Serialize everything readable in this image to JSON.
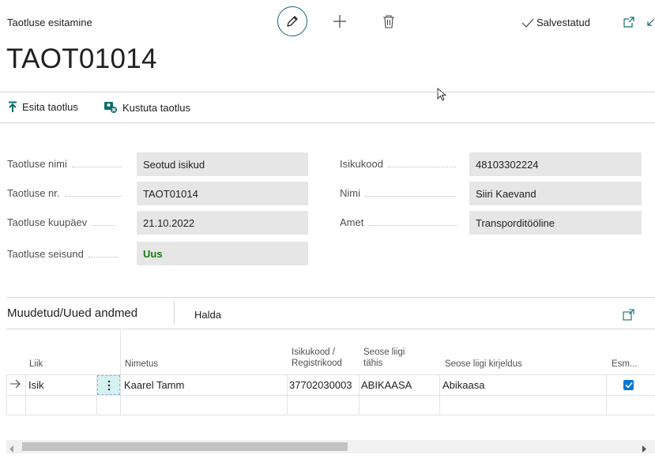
{
  "header": {
    "caption": "Taotluse esitamine",
    "title": "TAOT01014",
    "saved_status": "Salvestatud"
  },
  "actions": {
    "submit": "Esita taotlus",
    "delete": "Kustuta taotlus"
  },
  "fields_left": [
    {
      "label": "Taotluse nimi",
      "value": "Seotud isikud"
    },
    {
      "label": "Taotluse nr.",
      "value": "TAOT01014"
    },
    {
      "label": "Taotluse kuupäev",
      "value": "21.10.2022"
    },
    {
      "label": "Taotluse seisund",
      "value": "Uus"
    }
  ],
  "fields_right": [
    {
      "label": "Isikukood",
      "value": "48103302224"
    },
    {
      "label": "Nimi",
      "value": "Siiri Kaevand"
    },
    {
      "label": "Amet",
      "value": "Transporditööline"
    }
  ],
  "subpage": {
    "title": "Muudetud/Uued andmed",
    "manage": "Halda",
    "columns": {
      "liik": "Liik",
      "nimetus": "Nimetus",
      "isikukood_1": "Isikukood /",
      "isikukood_2": "Registrikood",
      "seose_1": "Seose liigi",
      "seose_2": "tähis",
      "kirjeldus": "Seose liigi kirjeldus",
      "esm": "Esm..."
    },
    "rows": [
      {
        "liik": "Isik",
        "nimetus": "Kaarel Tamm",
        "isikukood": "37702030003",
        "tahis": "ABIKAASA",
        "kirjeldus": "Abikaasa",
        "esm": true
      }
    ]
  },
  "colors": {
    "accent": "#0f6c6c",
    "status_green": "#107c10",
    "checkbox_blue": "#0078d4"
  }
}
